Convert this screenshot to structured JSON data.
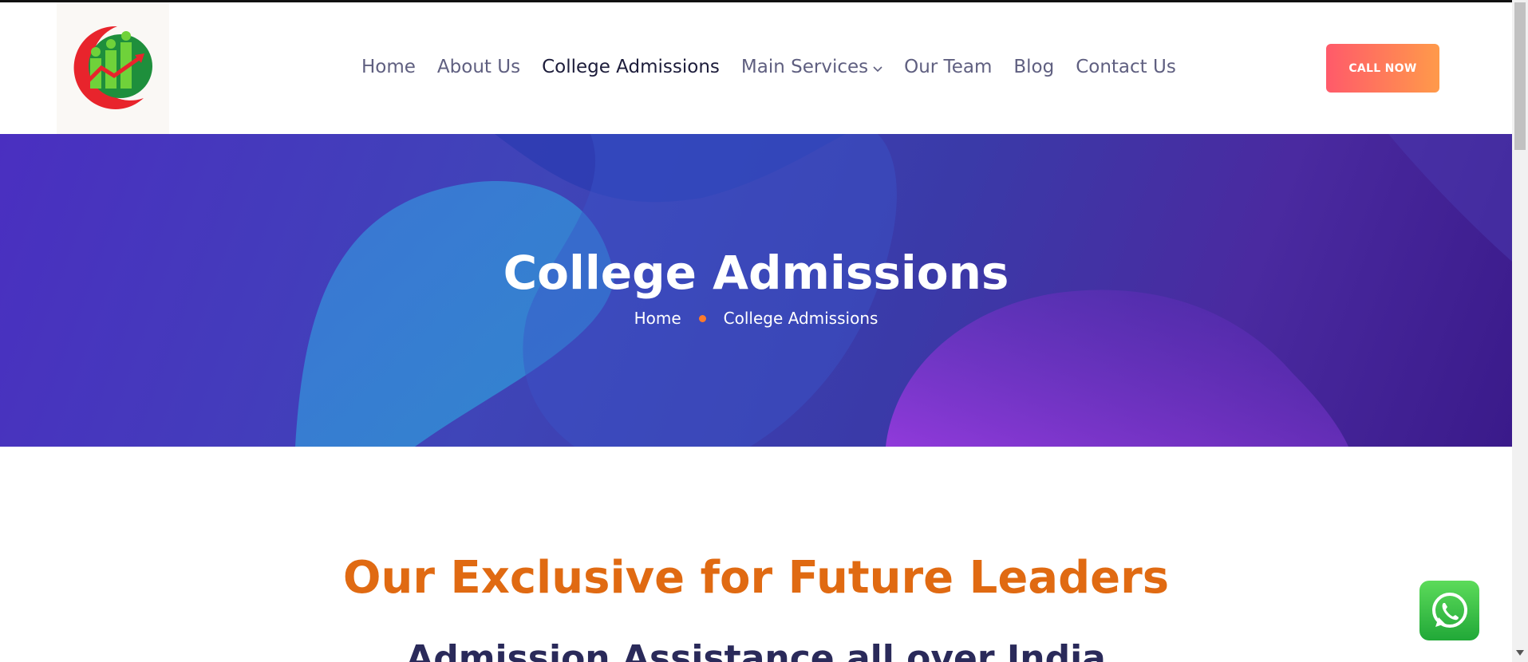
{
  "header": {
    "logo_icon": "company-logo",
    "nav": [
      {
        "label": "Home",
        "active": false
      },
      {
        "label": "About Us",
        "active": false
      },
      {
        "label": "College Admissions",
        "active": true
      },
      {
        "label": "Main Services",
        "active": false,
        "dropdown": true
      },
      {
        "label": "Our Team",
        "active": false
      },
      {
        "label": "Blog",
        "active": false
      },
      {
        "label": "Contact Us",
        "active": false
      }
    ],
    "cta_label": "CALL NOW"
  },
  "hero": {
    "title": "College Admissions",
    "breadcrumb": [
      "Home",
      "College Admissions"
    ]
  },
  "main": {
    "heading": "Our Exclusive for Future Leaders",
    "subheading": "Admission Assistance all over India"
  },
  "widgets": {
    "whatsapp_icon": "whatsapp-icon"
  },
  "colors": {
    "accent_orange": "#e06a12",
    "cta_gradient_start": "#ff5a6a",
    "cta_gradient_end": "#ff9a4a",
    "hero_purple": "#4a2fc0",
    "whatsapp_green": "#25d366"
  }
}
